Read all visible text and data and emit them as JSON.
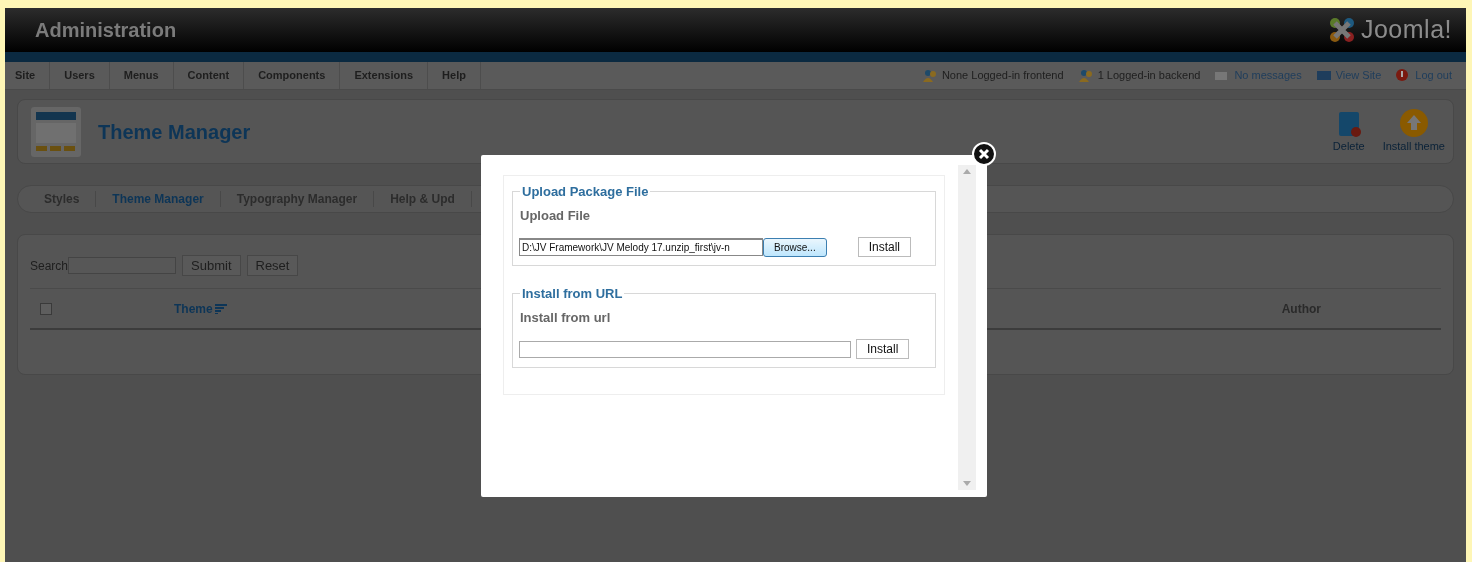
{
  "header": {
    "title": "Administration",
    "logo_text": "Joomla!"
  },
  "menu": [
    {
      "label": "Site"
    },
    {
      "label": "Users"
    },
    {
      "label": "Menus"
    },
    {
      "label": "Content"
    },
    {
      "label": "Components"
    },
    {
      "label": "Extensions"
    },
    {
      "label": "Help"
    }
  ],
  "status": [
    {
      "kind": "users",
      "text": "None Logged-in frontend",
      "link": false
    },
    {
      "kind": "users",
      "text": "1 Logged-in backend",
      "link": false
    },
    {
      "kind": "mail",
      "text": "No messages",
      "link": true
    },
    {
      "kind": "screen",
      "text": "View Site",
      "link": true
    },
    {
      "kind": "logout",
      "text": "Log out",
      "link": true
    }
  ],
  "toolbar": {
    "title": "Theme Manager",
    "buttons": [
      {
        "kind": "delete",
        "label": "Delete"
      },
      {
        "kind": "install",
        "label": "Install theme"
      }
    ]
  },
  "subtabs": [
    {
      "label": "Styles",
      "selected": false
    },
    {
      "label": "Theme Manager",
      "selected": true
    },
    {
      "label": "Typography Manager",
      "selected": false
    },
    {
      "label": "Help & Upd",
      "selected": false
    }
  ],
  "search": {
    "label": "Search",
    "buttons": [
      "Submit",
      "Reset"
    ]
  },
  "table": {
    "select_all_checked": false,
    "columns": [
      {
        "label": "Theme",
        "sortable": true
      },
      {
        "label": "Author",
        "sortable": false
      }
    ]
  },
  "modal": {
    "sections": [
      {
        "kind": "file",
        "legend": "Upload Package File",
        "label": "Upload File",
        "value": "D:\\JV Framework\\JV Melody 17.unzip_first\\jv-n",
        "browse": "Browse...",
        "button": "Install"
      },
      {
        "kind": "url",
        "legend": "Install from URL",
        "label": "Install from url",
        "button": "Install"
      }
    ]
  }
}
